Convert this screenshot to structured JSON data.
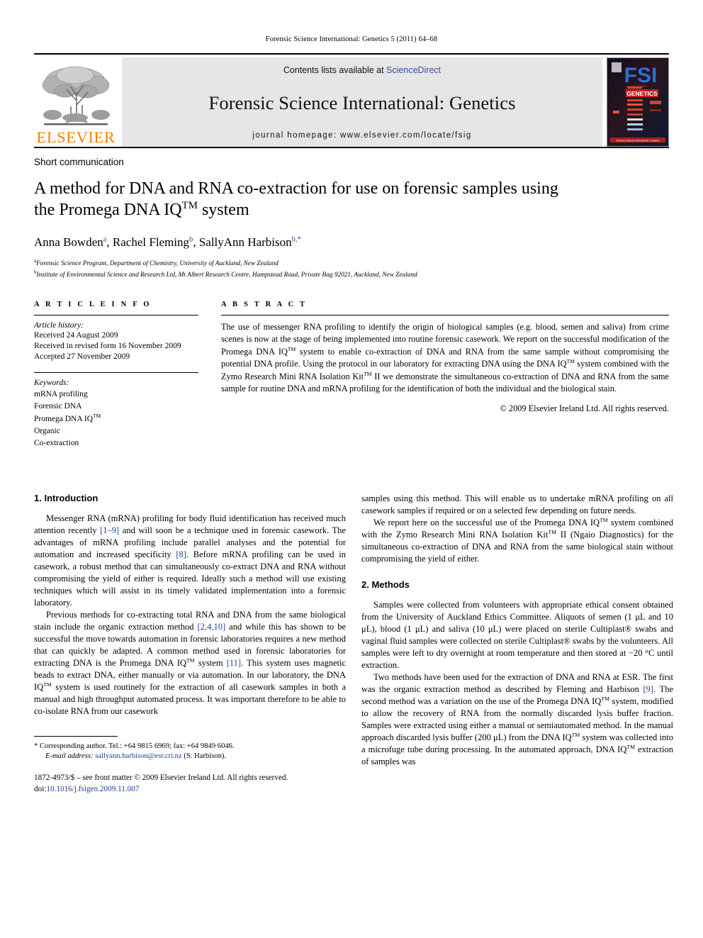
{
  "running_head": "Forensic Science International: Genetics 5 (2011) 64–68",
  "masthead": {
    "publisher_wordmark": "ELSEVIER",
    "contents_prefix": "Contents lists available at ",
    "contents_link": "ScienceDirect",
    "journal_title": "Forensic Science International: Genetics",
    "homepage_line": "journal homepage: www.elsevier.com/locate/fsig",
    "cover": {
      "brand": "FSI",
      "subtitle": "GENETICS",
      "strip_caption": "Forensic Science International: Genetics"
    },
    "link_color": "#3b4ba0",
    "brand_orange": "#f28000"
  },
  "article": {
    "type": "Short communication",
    "title_line_1": "A method for DNA and RNA co-extraction for use on forensic samples using",
    "title_line_2_pre": "the Promega DNA IQ",
    "title_sup": "TM",
    "title_line_2_post": " system",
    "authors": [
      {
        "name": "Anna Bowden",
        "sup": "a",
        "sep": ", "
      },
      {
        "name": "Rachel Fleming",
        "sup": "b",
        "sep": ", "
      },
      {
        "name": "SallyAnn Harbison",
        "sup": "b,*",
        "sep": ""
      }
    ],
    "affiliations": [
      {
        "marker": "a",
        "text": "Forensic Science Program, Department of Chemistry, University of Auckland, New Zealand"
      },
      {
        "marker": "b",
        "text": "Institute of Environmental Science and Research Ltd, Mt Albert Research Centre, Hampstead Road, Private Bag 92021, Auckland, New Zealand"
      }
    ]
  },
  "article_info": {
    "heading": "A R T I C L E   I N F O",
    "history_label": "Article history:",
    "history": [
      "Received 24 August 2009",
      "Received in revised form 16 November 2009",
      "Accepted 27 November 2009"
    ],
    "keywords_label": "Keywords:",
    "keywords": [
      {
        "text": "mRNA profiling",
        "sup": ""
      },
      {
        "text": "Forensic DNA",
        "sup": ""
      },
      {
        "text": "Promega DNA IQ",
        "sup": "TM"
      },
      {
        "text": "Organic",
        "sup": ""
      },
      {
        "text": "Co-extraction",
        "sup": ""
      }
    ]
  },
  "abstract": {
    "heading": "A B S T R A C T",
    "paragraph_parts": [
      {
        "t": "The use of messenger RNA profiling to identify the origin of biological samples (e.g. blood, semen and saliva) from crime scenes is now at the stage of being implemented into routine forensic casework. We report on the successful modification of the Promega DNA IQ"
      },
      {
        "sup": "TM"
      },
      {
        "t": " system to enable co-extraction of DNA and RNA from the same sample without compromising the potential DNA profile. Using the protocol in our laboratory for extracting DNA using the DNA IQ"
      },
      {
        "sup": "TM"
      },
      {
        "t": " system combined with the Zymo Research Mini RNA Isolation Kit"
      },
      {
        "sup": "TM"
      },
      {
        "t": " II we demonstrate the simultaneous co-extraction of DNA and RNA from the same sample for routine DNA and mRNA profiling for the identification of both the individual and the biological stain."
      }
    ],
    "copyright": "© 2009 Elsevier Ireland Ltd. All rights reserved."
  },
  "body": {
    "left": {
      "section_1_heading": "1. Introduction",
      "p1_parts": [
        {
          "t": "Messenger RNA (mRNA) profiling for body fluid identification has received much attention recently "
        },
        {
          "ref": "[1–9]"
        },
        {
          "t": " and will soon be a technique used in forensic casework. The advantages of mRNA profiling include parallel analyses and the potential for automation and increased specificity "
        },
        {
          "ref": "[8]"
        },
        {
          "t": ". Before mRNA profiling can be used in casework, a robust method that can simultaneously co-extract DNA and RNA without compromising the yield of either is required. Ideally such a method will use existing techniques which will assist in its timely validated implementation into a forensic laboratory."
        }
      ],
      "p2_parts": [
        {
          "t": "Previous methods for co-extracting total RNA and DNA from the same biological stain include the organic extraction method "
        },
        {
          "ref": "[2,4,10]"
        },
        {
          "t": " and while this has shown to be successful the move towards automation in forensic laboratories requires a new method that can quickly be adapted. A common method used in forensic laboratories for extracting DNA is the Promega DNA IQ"
        },
        {
          "sup": "TM"
        },
        {
          "t": " system "
        },
        {
          "ref": "[11]"
        },
        {
          "t": ". This system uses magnetic beads to extract DNA, either manually or via automation. In our laboratory, the DNA IQ"
        },
        {
          "sup": "TM"
        },
        {
          "t": " system is used routinely for the extraction of all casework samples in both a manual and high throughput automated process. It was important therefore to be able to co-isolate RNA from our casework"
        }
      ],
      "footnote": {
        "marker": "*",
        "corresponding": "Corresponding author. Tel.: +64 9815 6969; fax: +64 9849 6046.",
        "email_label": "E-mail address:",
        "email": "sallyann.harbison@esr.cri.nz",
        "email_suffix": " (S. Harbison)."
      },
      "imprint": {
        "line1": "1872-4973/$ – see front matter © 2009 Elsevier Ireland Ltd. All rights reserved.",
        "doi_label": "doi:",
        "doi_value": "10.1016/j.fsigen.2009.11.007"
      }
    },
    "right": {
      "p1_parts": [
        {
          "t": "samples using this method. This will enable us to undertake mRNA profiling on all casework samples if required or on a selected few depending on future needs."
        }
      ],
      "p2_parts": [
        {
          "t": "We report here on the successful use of the Promega DNA IQ"
        },
        {
          "sup": "TM"
        },
        {
          "t": " system combined with the Zymo Research Mini RNA Isolation Kit"
        },
        {
          "sup": "TM"
        },
        {
          "t": " II (Ngaio Diagnostics) for the simultaneous co-extraction of DNA and RNA from the same biological stain without compromising the yield of either."
        }
      ],
      "section_2_heading": "2. Methods",
      "p3_parts": [
        {
          "t": "Samples were collected from volunteers with appropriate ethical consent obtained from the University of Auckland Ethics Committee. Aliquots of semen (1 μL and 10 μL), blood (1 μL) and saliva (10 μL) were placed on sterile Cultiplast® swabs and vaginal fluid samples were collected on sterile Cultiplast® swabs by the volunteers. All samples were left to dry overnight at room temperature and then stored at −20 °C until extraction."
        }
      ],
      "p4_parts": [
        {
          "t": "Two methods have been used for the extraction of DNA and RNA at ESR. The first was the organic extraction method as described by Fleming and Harbison "
        },
        {
          "ref": "[9]"
        },
        {
          "t": ". The second method was a variation on the use of the Promega DNA IQ"
        },
        {
          "sup": "TM"
        },
        {
          "t": " system, modified to allow the recovery of RNA from the normally discarded lysis buffer fraction. Samples were extracted using either a manual or semiautomated method. In the manual approach discarded lysis buffer (200 μL) from the DNA IQ"
        },
        {
          "sup": "TM"
        },
        {
          "t": " system was collected into a microfuge tube during processing. In the automated approach, DNA IQ"
        },
        {
          "sup": "TM"
        },
        {
          "t": " extraction of samples was"
        }
      ]
    }
  }
}
